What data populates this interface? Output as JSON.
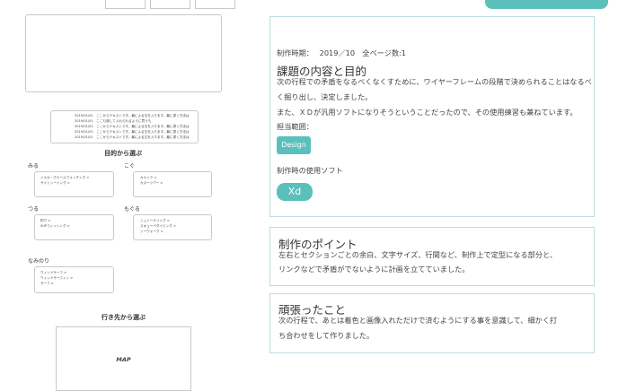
{
  "wireframe": {
    "news_lines": [
      "2019/01/01　ここからテキストです。最による文を入ります。最に書く方法は",
      "2019/01/01　ここも検して入れられるように買うも",
      "2019/01/01　ここからテキストです。最による文を入ります。最に書く方法は",
      "2019/01/01　ここからテキストです。最による文を入ります。最に書く方法は",
      "2019/01/01　ここからテキストです。最による文を入ります。最に書く方法は"
    ],
    "purpose_title": "目的から選ぶ",
    "categories": {
      "miru": {
        "label": "みる",
        "items": [
          "イルカ・ホエールウォッチング >",
          "サイトシーイング >"
        ]
      },
      "kogu": {
        "label": "こぐ",
        "items": [
          "カヤック >",
          "カヌーツアー >"
        ]
      },
      "tsuru": {
        "label": "つる",
        "items": [
          "釣り >",
          "SUPフィッシング >"
        ]
      },
      "moguru": {
        "label": "もぐる",
        "items": [
          "シュノーケリング >",
          "スキューバダイビング >",
          "シーウォーク >"
        ]
      },
      "naminori": {
        "label": "なみのり",
        "items": [
          "ウィンドサーフ >",
          "ウィンドサーフィン >",
          "サーフ >"
        ]
      }
    },
    "destination_title": "行き先から選ぶ",
    "map_label": "MAP"
  },
  "details": {
    "meta": "制作時期：　 2019／10　全ページ数:1",
    "theme_heading": "課題の内容と目的",
    "theme_lines": [
      "次の行程での矛盾をなるべくなくすために、ワイヤーフレームの段階で決められることはなるべ",
      "く掘り出し、決定しました。",
      "また、ＸＤが汎用ソフトになりそうということだったので、その使用練習も兼ねています。"
    ],
    "role_label": "担当範囲：",
    "role_tag": "Design",
    "software_label": "制作時の使用ソフト",
    "software_tag": "Xd"
  },
  "point": {
    "heading": "制作のポイント",
    "lines": [
      "左右とセクションごとの余白、文字サイズ、行間など、制作上で定型になる部分と、",
      "リンクなどで矛盾がでないように計画を立てていました。"
    ]
  },
  "effort": {
    "heading": "頑張ったこと",
    "lines": [
      "次の行程で、あとは着色と画像入れただけで済むようにする事を意識して、細かく打",
      "ち合わせをして作りました。"
    ]
  },
  "colors": {
    "accent": "#5bc0bc",
    "panel_border": "#b9dfe0"
  }
}
